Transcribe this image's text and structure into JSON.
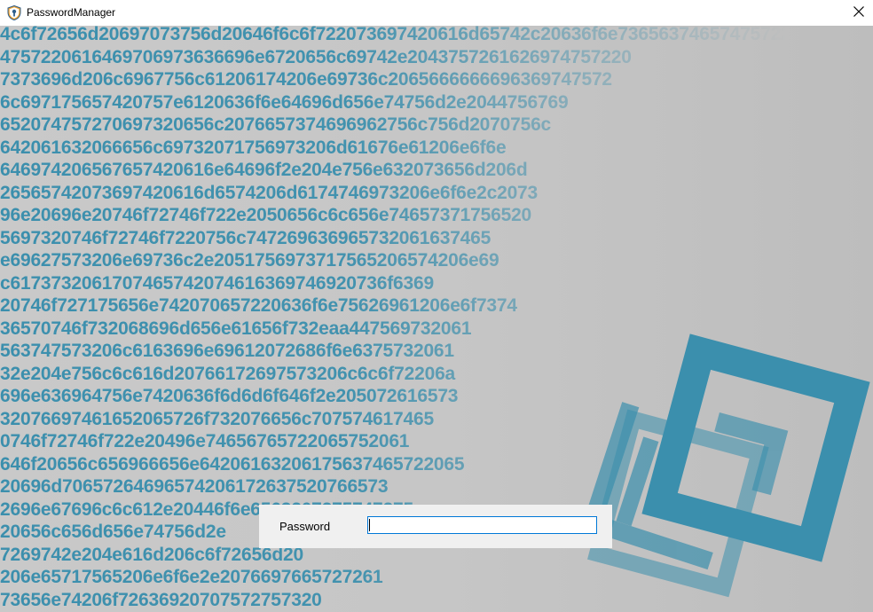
{
  "window": {
    "title": "PasswordManager",
    "app_icon": "shield-key-icon",
    "close_icon": "close-icon"
  },
  "background": {
    "hex_color": "#3b8fad",
    "hex_lines": [
      "4c6f72656d20697073756d20646f6c6f722073697420616d65742c20636f6e736563746574757220",
      "4757220616469706973636696e6720656c69742e2043757261626974757220",
      "7373696d206c6967756c61206174206e69736c2065666666696369747572",
      "6c697175657420757e6120636f6e64696d656e74756d2e2044756769",
      "652074757270697320656c2076657374696962756c756d2070756c",
      "642061632066656c69732071756973206d61676e61206e6f6e",
      "646974206567657420616e64696f2e204e756e632073656d206d",
      "26565742073697420616d6574206d6174746973206e6f6e2c2073",
      "96e20696e20746f72746f722e2050656c6c656e74657371756520",
      "5697320746f72746f7220756c747269636965732061637465",
      "e69627573206e69736c2e2051756973717565206574206e69",
      "c6173732061707465742074616369746920736f6369",
      "20746f727175656e742070657220636f6e75626961206e6f7374",
      "36570746f732068696d656e61656f732eaa447569732061",
      "563747573206c6163696e69612072686f6e6375732061",
      "32e204e756c6c616d20766172697573206c6c6f72206a",
      "696e636964756e7420636f6d6d6f646f2e205072616573",
      "32076697461652065726f732076656c707574617465",
      "0746f72746f722e20496e74656765722065752061",
      "646f20656c656966656e64206163206175637465722065",
      "20696d70657264696574206172637520766573",
      "2696e67696c6c612e20446f6e6563207275747275",
      "20656c656d656e74756d2e",
      "7269742e204e616d206c6f72656d20",
      "206e65717565206e6f6e2e2076697665727261",
      "73656e74206f72636920707572757320"
    ]
  },
  "login": {
    "password_label": "Password",
    "password_value": ""
  }
}
